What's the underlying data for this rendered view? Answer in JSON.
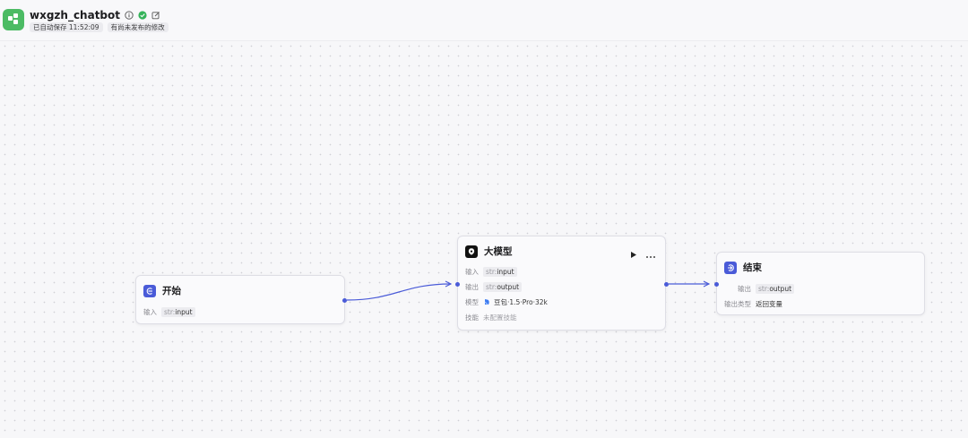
{
  "header": {
    "app_name": "wxgzh_chatbot",
    "autosave_label": "已自动保存 11:52:09",
    "unpublished_label": "有尚未发布的修改",
    "icons": [
      "info-icon",
      "verified-check-icon",
      "edit-icon"
    ],
    "accent_color": "#4cbb64"
  },
  "nodes": {
    "start": {
      "title": "开始",
      "input_label": "输入",
      "input_type": "str:",
      "input_name": "input",
      "icon": "start-icon",
      "icon_color": "#4a5bd8"
    },
    "llm": {
      "title": "大模型",
      "input_label": "输入",
      "input_type": "str:",
      "input_name": "input",
      "output_label": "输出",
      "output_type": "str:",
      "output_name": "output",
      "model_label": "模型",
      "model_value": "豆包·1.5·Pro·32k",
      "skill_label": "技能",
      "skill_value": "未配置技能",
      "icon": "llm-icon"
    },
    "end": {
      "title": "结束",
      "output_label": "输出",
      "output_type": "str:",
      "output_name": "output",
      "output_kind_label": "输出类型",
      "output_kind_value": "返回变量",
      "icon": "end-icon",
      "icon_color": "#4a5bd8"
    }
  },
  "edge_color": "#4a5bd8"
}
